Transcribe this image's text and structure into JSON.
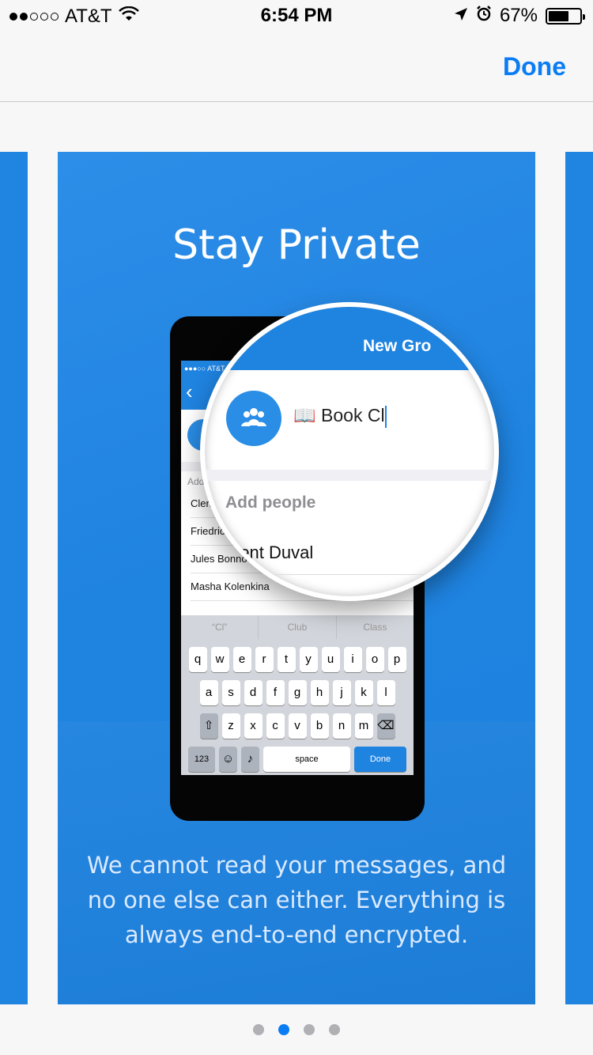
{
  "status_bar": {
    "carrier": "AT&T",
    "time": "6:54 PM",
    "battery": "67%",
    "battery_level": 0.67,
    "signal_filled": 2,
    "signal_total": 5
  },
  "nav": {
    "done_label": "Done"
  },
  "card": {
    "title": "Stay Private",
    "description": "We cannot read your messages, and no one else can either. Everything is always end-to-end encrypted."
  },
  "phone_mockup": {
    "status": "●●●○○ AT&T",
    "add_label": "Add",
    "rows": [
      "Clen",
      "Friedric",
      "Jules Bonno",
      "Masha Kolenkina"
    ],
    "suggestions": [
      "“Cl”",
      "Club",
      "Class"
    ],
    "keys_row1": [
      "q",
      "w",
      "e",
      "r",
      "t",
      "y",
      "u",
      "i",
      "o",
      "p"
    ],
    "keys_row2": [
      "a",
      "s",
      "d",
      "f",
      "g",
      "h",
      "j",
      "k",
      "l"
    ],
    "keys_row3": [
      "z",
      "x",
      "c",
      "v",
      "b",
      "n",
      "m"
    ],
    "key_123": "123",
    "key_space": "space",
    "key_done": "Done"
  },
  "magnifier": {
    "title": "New Gro",
    "group_name": "📖 Book Cl",
    "add_people": "Add people",
    "contact": "ment Duval"
  },
  "pager": {
    "count": 4,
    "active_index": 1
  },
  "colors": {
    "accent": "#0a7cf4",
    "card_blue": "#1f83e0"
  }
}
